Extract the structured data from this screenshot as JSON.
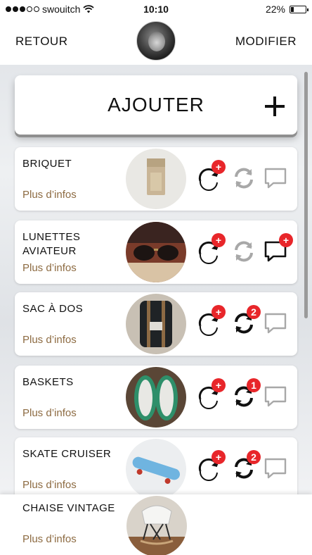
{
  "status_bar": {
    "carrier": "swouitch",
    "time": "10:10",
    "battery": "22%",
    "battery_level": 0.22,
    "signal_bars": 3,
    "signal_total": 5
  },
  "nav": {
    "back_label": "RETOUR",
    "edit_label": "MODIFIER"
  },
  "add_card": {
    "label": "AJOUTER"
  },
  "items": [
    {
      "name": "BRIQUET",
      "more": "Plus d’infos",
      "swap_badge": "+",
      "sync_badge": "",
      "chat_badge": "",
      "sync_active": false,
      "chat_active": false
    },
    {
      "name": "LUNETTES AVIATEUR",
      "more": "Plus d’infos",
      "swap_badge": "+",
      "sync_badge": "",
      "chat_badge": "+",
      "sync_active": false,
      "chat_active": true
    },
    {
      "name": "SAC À DOS",
      "more": "Plus d’infos",
      "swap_badge": "+",
      "sync_badge": "2",
      "chat_badge": "",
      "sync_active": true,
      "chat_active": false
    },
    {
      "name": "BASKETS",
      "more": "Plus d’infos",
      "swap_badge": "+",
      "sync_badge": "1",
      "chat_badge": "",
      "sync_active": true,
      "chat_active": false
    },
    {
      "name": "SKATE CRUISER",
      "more": "Plus d’infos",
      "swap_badge": "+",
      "sync_badge": "2",
      "chat_badge": "",
      "sync_active": true,
      "chat_active": false
    }
  ],
  "bottom_item": {
    "name": "CHAISE VINTAGE",
    "more": "Plus d’infos"
  },
  "colors": {
    "accent_link": "#8d6b42",
    "badge_red": "#e8262a",
    "icon_dark": "#111111",
    "icon_inactive": "#a8a8a8"
  }
}
